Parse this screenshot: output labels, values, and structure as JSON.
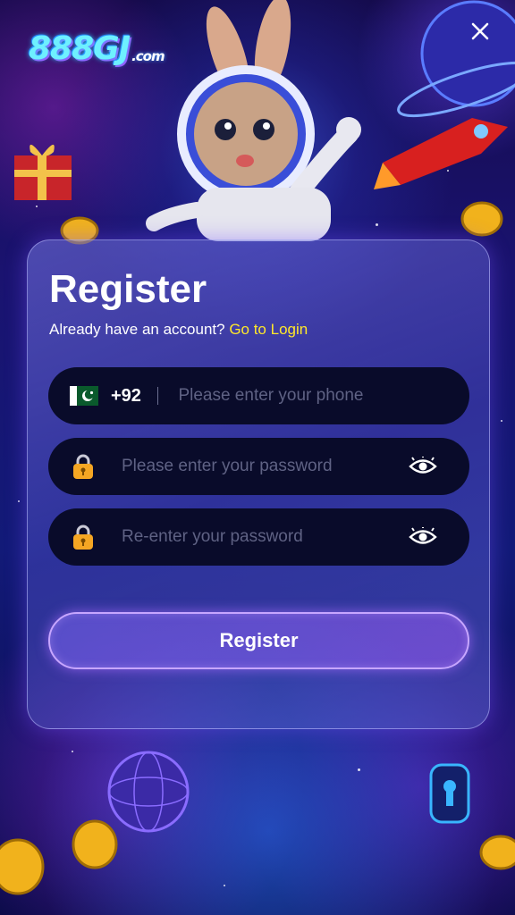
{
  "brand": {
    "logo_text": "888GJ",
    "logo_suffix": ".com"
  },
  "form": {
    "title": "Register",
    "subtitle_prefix": "Already have an account? ",
    "login_link": "Go to Login",
    "phone": {
      "country_code": "+92",
      "placeholder": "Please enter your phone",
      "value": ""
    },
    "password": {
      "placeholder": "Please enter your password",
      "value": ""
    },
    "confirm_password": {
      "placeholder": "Re-enter your password",
      "value": ""
    },
    "submit_label": "Register"
  },
  "icons": {
    "close": "close-icon",
    "flag": "pakistan-flag-icon",
    "lock": "lock-icon",
    "eye": "eye-icon"
  },
  "colors": {
    "accent_link": "#ffe82a",
    "field_bg": "#090b2a",
    "button_border": "#c7a6ff",
    "placeholder": "#5f6284"
  }
}
